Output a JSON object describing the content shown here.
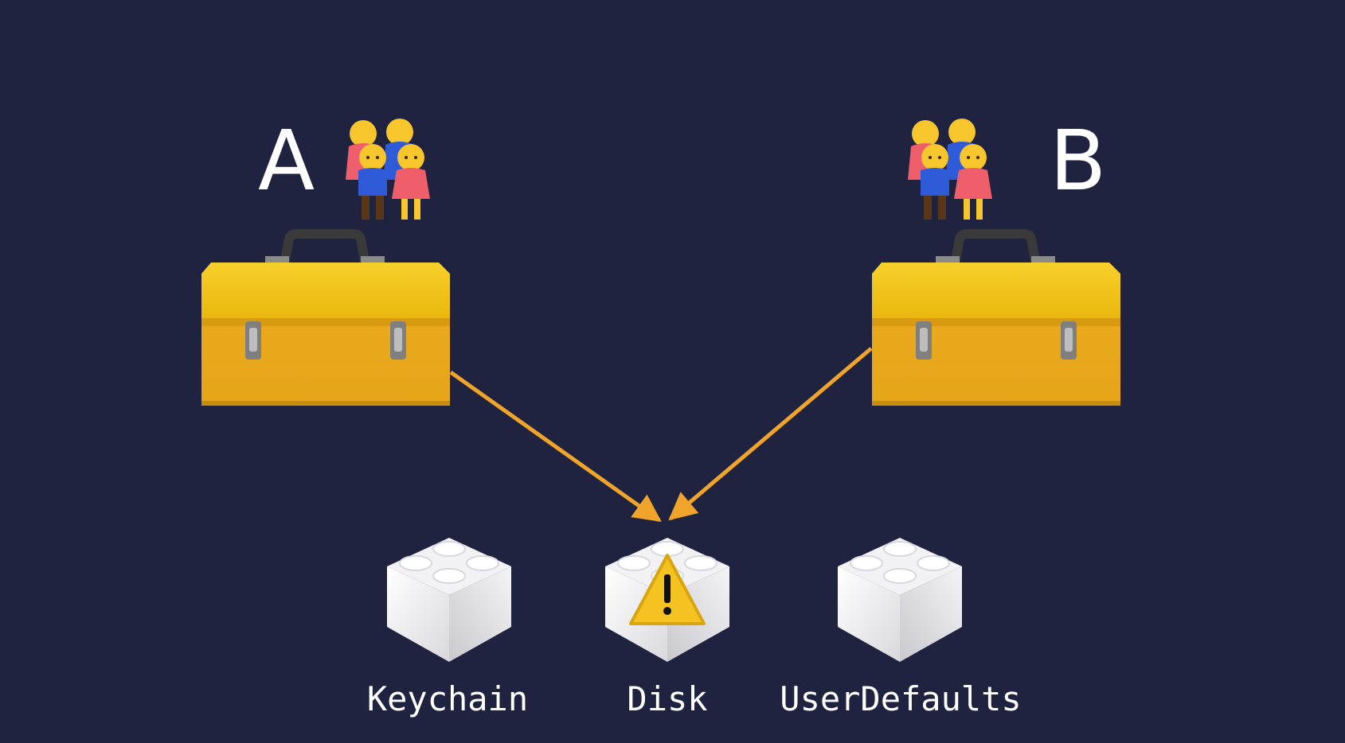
{
  "diagram": {
    "apps": [
      {
        "label": "A",
        "icon": "toolbox-icon",
        "group_icon": "family-icon"
      },
      {
        "label": "B",
        "icon": "toolbox-icon",
        "group_icon": "family-icon"
      }
    ],
    "stores": [
      {
        "label": "Keychain",
        "icon": "lego-brick-icon"
      },
      {
        "label": "Disk",
        "icon": "lego-brick-warning-icon"
      },
      {
        "label": "UserDefaults",
        "icon": "lego-brick-icon"
      }
    ],
    "colors": {
      "background": "#1f2340",
      "arrow": "#f0a52a",
      "toolbox": "#f0b814",
      "text": "#ffffff"
    }
  }
}
